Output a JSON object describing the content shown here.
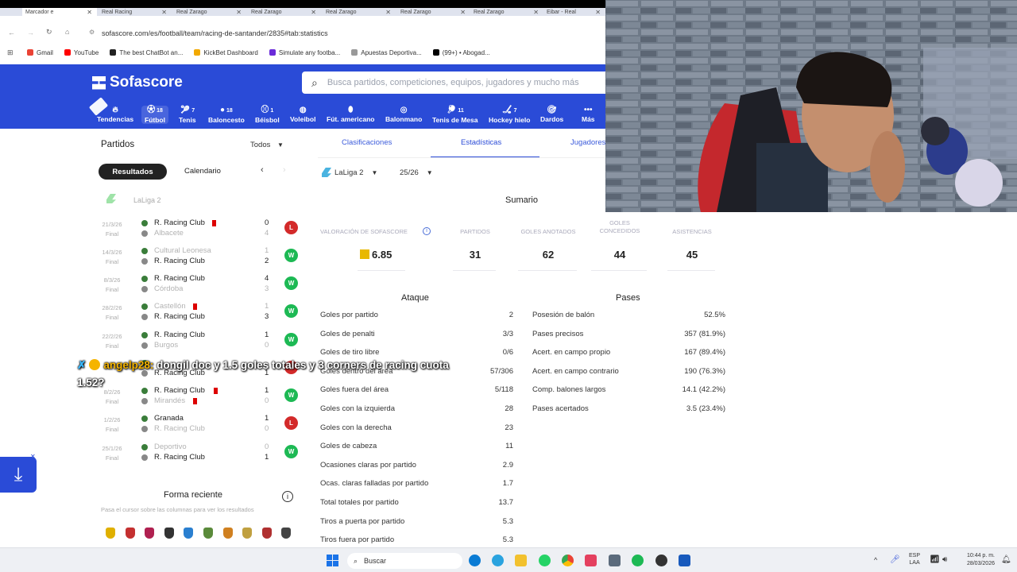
{
  "browser": {
    "tabs": [
      "Marcador e",
      "Real Racing",
      "Real Zarago",
      "Real Zarago",
      "Real Zarago",
      "Real Zarago",
      "Real Zarago",
      "Eibar - Real"
    ],
    "url": "sofascore.com/es/football/team/racing-de-santander/2835#tab:statistics",
    "bookmarks": [
      "Gmail",
      "YouTube",
      "The best ChatBot an...",
      "KickBet Dashboard",
      "Simulate any footba...",
      "Apuestas Deportiva...",
      "(99+) • Abogad..."
    ]
  },
  "header": {
    "logo": "Sofascore",
    "search_placeholder": "Busca partidos, competiciones, equipos, jugadores y mucho más",
    "nav": [
      {
        "label": "Tendencias",
        "count": ""
      },
      {
        "label": "Fútbol",
        "count": "18"
      },
      {
        "label": "Tenis",
        "count": "7"
      },
      {
        "label": "Baloncesto",
        "count": "18"
      },
      {
        "label": "Béisbol",
        "count": "1"
      },
      {
        "label": "Voleibol",
        "count": ""
      },
      {
        "label": "Fút. americano",
        "count": ""
      },
      {
        "label": "Balonmano",
        "count": ""
      },
      {
        "label": "Tenis de Mesa",
        "count": "11"
      },
      {
        "label": "Hockey hielo",
        "count": "7"
      },
      {
        "label": "Dardos",
        "count": ""
      },
      {
        "label": "Más",
        "count": ""
      }
    ]
  },
  "left": {
    "title": "Partidos",
    "filter": "Todos",
    "btn_results": "Resultados",
    "btn_calendar": "Calendario",
    "league": "LaLiga 2",
    "matches": [
      {
        "date": "21/3/26",
        "status": "Final",
        "home": "R. Racing Club",
        "away": "Albacete",
        "hs": "0",
        "as": "4",
        "res": "L"
      },
      {
        "date": "14/3/26",
        "status": "Final",
        "home": "Cultural Leonesa",
        "away": "R. Racing Club",
        "hs": "1",
        "as": "2",
        "res": "W"
      },
      {
        "date": "8/3/26",
        "status": "Final",
        "home": "R. Racing Club",
        "away": "Córdoba",
        "hs": "4",
        "as": "3",
        "res": "W"
      },
      {
        "date": "28/2/26",
        "status": "Final",
        "home": "Castellón",
        "away": "R. Racing Club",
        "hs": "1",
        "as": "3",
        "res": "W"
      },
      {
        "date": "22/2/26",
        "status": "Final",
        "home": "R. Racing Club",
        "away": "Burgos",
        "hs": "1",
        "as": "0",
        "res": "W"
      },
      {
        "date": "",
        "status": "",
        "home": "",
        "away": "R. Racing Club",
        "hs": "",
        "as": "1",
        "res": "L"
      },
      {
        "date": "8/2/26",
        "status": "Final",
        "home": "R. Racing Club",
        "away": "Mirandés",
        "hs": "1",
        "as": "0",
        "res": "W"
      },
      {
        "date": "1/2/26",
        "status": "Final",
        "home": "Granada",
        "away": "R. Racing Club",
        "hs": "1",
        "as": "0",
        "res": "L"
      },
      {
        "date": "25/1/26",
        "status": "Final",
        "home": "Deportivo",
        "away": "R. Racing Club",
        "hs": "0",
        "as": "1",
        "res": "W"
      }
    ],
    "form_title": "Forma reciente",
    "form_hint": "Pasa el cursor sobre las columnas para ver los resultados"
  },
  "chat": {
    "user": "angelp28:",
    "message": "dongil doc y 1.5 goles totales y 3 corners de racing cuota 1.52?"
  },
  "stats": {
    "tabs": [
      "Clasificaciones",
      "Estadísticas",
      "Jugadores"
    ],
    "league_select": "LaLiga 2",
    "season_select": "25/26",
    "summary_title": "Sumario",
    "summary": [
      {
        "label": "VALORACIÓN DE SOFASCORE",
        "value": "6.85"
      },
      {
        "label": "PARTIDOS",
        "value": "31"
      },
      {
        "label": "GOLES ANOTADOS",
        "value": "62"
      },
      {
        "label": "GOLES CONCEDIDOS",
        "value": "44"
      },
      {
        "label": "ASISTENCIAS",
        "value": "45"
      }
    ],
    "attack_title": "Ataque",
    "attack": [
      {
        "label": "Goles por partido",
        "value": "2"
      },
      {
        "label": "Goles de penalti",
        "value": "3/3"
      },
      {
        "label": "Goles de tiro libre",
        "value": "0/6"
      },
      {
        "label": "Goles dentro del área",
        "value": "57/306"
      },
      {
        "label": "Goles fuera del área",
        "value": "5/118"
      },
      {
        "label": "Goles con la izquierda",
        "value": "28"
      },
      {
        "label": "Goles con la derecha",
        "value": "23"
      },
      {
        "label": "Goles de cabeza",
        "value": "11"
      },
      {
        "label": "Ocasiones claras por partido",
        "value": "2.9"
      },
      {
        "label": "Ocas. claras falladas por partido",
        "value": "1.7"
      },
      {
        "label": "Total totales por partido",
        "value": "13.7"
      },
      {
        "label": "Tiros a puerta por partido",
        "value": "5.3"
      },
      {
        "label": "Tiros fuera por partido",
        "value": "5.3"
      }
    ],
    "passes_title": "Pases",
    "passes": [
      {
        "label": "Posesión de balón",
        "value": "52.5%"
      },
      {
        "label": "Pases precisos",
        "value": "357 (81.9%)"
      },
      {
        "label": "Acert. en campo propio",
        "value": "167 (89.4%)"
      },
      {
        "label": "Acert. en campo contrario",
        "value": "190 (76.3%)"
      },
      {
        "label": "Comp. balones largos",
        "value": "14.1 (42.2%)"
      },
      {
        "label": "Pases acertados",
        "value": "3.5 (23.4%)"
      }
    ]
  },
  "taskbar": {
    "search": "Buscar",
    "lang": "ESP",
    "lang2": "LAA",
    "time": "10:44 p. m.",
    "date": "28/03/2026"
  },
  "colors": {
    "brand": "#2a4bd7",
    "win": "#1db954",
    "loss": "#d32a2a"
  }
}
